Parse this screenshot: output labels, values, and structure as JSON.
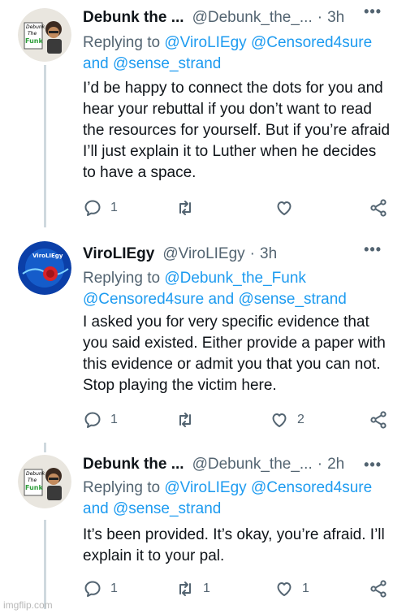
{
  "tweets": [
    {
      "name": "Debunk the ...",
      "handle": "@Debunk_the_...",
      "dot": "·",
      "time": "3h",
      "replying_prefix": "Replying to",
      "mention1": "@ViroLIEgy",
      "mention2": "@Censored4sure",
      "and": "and",
      "mention3": "@sense_strand",
      "body": "I’d be happy to connect the dots for you and hear your rebuttal if you don’t want to read the resources for yourself. But if you’re afraid I’ll just explain it to Luther when he decides to have a space.",
      "reply_count": "1",
      "retweet_count": "",
      "like_count": ""
    },
    {
      "name": "ViroLIEgy",
      "handle": "@ViroLIEgy",
      "dot": "·",
      "time": "3h",
      "replying_prefix": "Replying to",
      "mention1": "@Debunk_the_Funk",
      "mention2": "@Censored4sure",
      "and": "and",
      "mention3": "@sense_strand",
      "body": "I asked you for very specific evidence that you said existed. Either provide a paper with this evidence or admit you that you can not. Stop playing the victim here.",
      "reply_count": "1",
      "retweet_count": "",
      "like_count": "2"
    },
    {
      "name": "Debunk the ...",
      "handle": "@Debunk_the_...",
      "dot": "·",
      "time": "2h",
      "replying_prefix": "Replying to",
      "mention1": "@ViroLIEgy",
      "mention2": "@Censored4sure",
      "and": "and",
      "mention3": "@sense_strand",
      "body": "It’s been provided. It’s okay, you’re afraid. I’ll explain it to your pal.",
      "reply_count": "1",
      "retweet_count": "1",
      "like_count": "1"
    }
  ],
  "avatars": {
    "debunk_text_1": "Debunk",
    "debunk_text_2": "The",
    "debunk_text_3": "Funk",
    "virology_text": "ViroLIEgy"
  },
  "more_glyph": "•••",
  "watermark": "imgflip.com",
  "colors": {
    "link": "#1d9bf0",
    "muted": "#536471",
    "text": "#0f1419",
    "thread_line": "#cfd9de"
  },
  "icons": [
    "reply-icon",
    "retweet-icon",
    "like-icon",
    "share-icon",
    "more-icon"
  ]
}
